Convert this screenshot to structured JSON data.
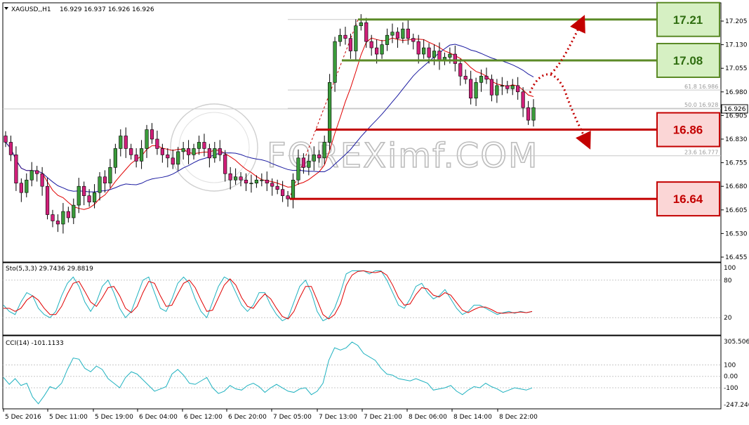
{
  "header": {
    "symbol_label": "XAGUSD,,H1",
    "ohlc": "16.929 16.937 16.926 16.926"
  },
  "watermark": "FOREXimf.COM",
  "chart_data": [
    {
      "type": "candlestick",
      "title": "XAGUSD,,H1",
      "ylim": [
        16.455,
        17.28
      ],
      "y_ticks": [
        "17.205",
        "17.130",
        "17.055",
        "16.980",
        "16.905",
        "16.830",
        "16.755",
        "16.680",
        "16.605",
        "16.530",
        "16.455"
      ],
      "y_tick_values": [
        17.205,
        17.13,
        17.055,
        16.98,
        16.905,
        16.83,
        16.755,
        16.68,
        16.605,
        16.53,
        16.455
      ],
      "current_price": "16.926",
      "x_ticks": [
        "5 Dec 2016",
        "5 Dec 11:00",
        "5 Dec 19:00",
        "6 Dec 04:00",
        "6 Dec 12:00",
        "6 Dec 20:00",
        "7 Dec 05:00",
        "7 Dec 13:00",
        "7 Dec 21:00",
        "8 Dec 06:00",
        "8 Dec 14:00",
        "8 Dec 22:00"
      ],
      "candles_close": [
        16.82,
        16.78,
        16.69,
        16.66,
        16.7,
        16.73,
        16.72,
        16.68,
        16.59,
        16.57,
        16.56,
        16.6,
        16.58,
        16.62,
        16.68,
        16.65,
        16.63,
        16.66,
        16.71,
        16.69,
        16.74,
        16.8,
        16.84,
        16.8,
        16.78,
        16.76,
        16.8,
        16.86,
        16.83,
        16.8,
        16.78,
        16.77,
        16.75,
        16.79,
        16.8,
        16.78,
        16.8,
        16.82,
        16.8,
        16.77,
        16.8,
        16.78,
        16.72,
        16.7,
        16.71,
        16.7,
        16.69,
        16.69,
        16.7,
        16.7,
        16.69,
        16.68,
        16.67,
        16.65,
        16.64,
        16.7,
        16.77,
        16.74,
        16.76,
        16.78,
        16.77,
        16.82,
        17.01,
        17.14,
        17.16,
        17.15,
        17.11,
        17.19,
        17.2,
        17.14,
        17.12,
        17.1,
        17.13,
        17.16,
        17.17,
        17.15,
        17.18,
        17.15,
        17.14,
        17.1,
        17.12,
        17.09,
        17.11,
        17.08,
        17.09,
        17.1,
        17.07,
        17.03,
        17.02,
        16.96,
        17.01,
        17.03,
        17.02,
        16.97,
        17.0,
        17.0,
        16.99,
        17.0,
        16.98,
        16.93,
        16.89,
        16.93
      ],
      "annotations": {
        "fib_levels": [
          "61.8 16.986",
          "50.0 16.928",
          "23.6 16.777"
        ]
      },
      "levels": [
        {
          "label": "17.21",
          "value": 17.21,
          "color": "#5b8a27"
        },
        {
          "label": "17.08",
          "value": 17.08,
          "color": "#5b8a27"
        },
        {
          "label": "16.86",
          "value": 16.86,
          "color": "#c30000"
        },
        {
          "label": "16.64",
          "value": 16.64,
          "color": "#c30000"
        }
      ]
    },
    {
      "type": "line",
      "title": "Sto(5,3,3) 29.7436 29.8819",
      "ylim": [
        0,
        100
      ],
      "y_ticks": [
        "100",
        "80",
        "20"
      ],
      "y_tick_values": [
        100,
        80,
        20
      ],
      "series": [
        {
          "values": [
            40,
            30,
            25,
            45,
            60,
            55,
            35,
            25,
            20,
            30,
            55,
            75,
            85,
            70,
            45,
            30,
            45,
            70,
            80,
            60,
            35,
            20,
            30,
            55,
            80,
            85,
            60,
            35,
            30,
            50,
            75,
            85,
            75,
            50,
            30,
            20,
            45,
            70,
            85,
            80,
            60,
            40,
            30,
            40,
            60,
            60,
            40,
            25,
            15,
            20,
            45,
            70,
            80,
            60,
            30,
            15,
            20,
            35,
            60,
            90,
            95,
            95,
            95,
            90,
            95,
            95,
            80,
            60,
            40,
            35,
            50,
            70,
            75,
            60,
            50,
            55,
            65,
            50,
            35,
            25,
            30,
            40,
            40,
            35,
            30,
            25,
            28,
            30,
            27,
            30,
            28,
            29.7
          ]
        },
        {
          "values": [
            35,
            35,
            30,
            35,
            48,
            55,
            48,
            35,
            25,
            25,
            38,
            58,
            75,
            78,
            62,
            45,
            38,
            52,
            68,
            70,
            55,
            35,
            28,
            38,
            60,
            78,
            75,
            55,
            38,
            40,
            58,
            75,
            80,
            68,
            48,
            30,
            32,
            52,
            72,
            82,
            72,
            52,
            38,
            35,
            48,
            58,
            50,
            35,
            22,
            18,
            30,
            52,
            70,
            70,
            48,
            25,
            18,
            25,
            42,
            72,
            88,
            94,
            95,
            93,
            92,
            94,
            88,
            72,
            52,
            40,
            42,
            57,
            68,
            66,
            56,
            53,
            60,
            56,
            44,
            32,
            28,
            33,
            37,
            37,
            33,
            28,
            27,
            28,
            28,
            29,
            28,
            29.9
          ]
        }
      ]
    },
    {
      "type": "line",
      "title": "CCI(14) -101.1133",
      "ylim": [
        -247.246,
        305.5063
      ],
      "y_ticks": [
        "305.5063",
        "100",
        "0.00",
        "-100",
        "-247.246"
      ],
      "y_tick_values": [
        305.5063,
        100,
        0,
        -100,
        -247.246
      ],
      "series": [
        {
          "values": [
            -10,
            -70,
            -20,
            -80,
            -60,
            -180,
            -240,
            -170,
            -90,
            -110,
            -60,
            60,
            160,
            150,
            70,
            40,
            90,
            60,
            -20,
            -60,
            -100,
            -10,
            40,
            20,
            -30,
            -80,
            -130,
            -110,
            -90,
            20,
            60,
            10,
            -60,
            -70,
            -40,
            -10,
            -100,
            -150,
            -130,
            -80,
            -110,
            -120,
            -80,
            -60,
            -90,
            -140,
            -100,
            -70,
            -100,
            -130,
            -140,
            -110,
            -100,
            -160,
            -130,
            -60,
            140,
            250,
            230,
            250,
            300,
            270,
            200,
            170,
            140,
            70,
            20,
            10,
            -20,
            -30,
            -40,
            -20,
            -40,
            -60,
            -120,
            -110,
            -100,
            -80,
            -130,
            -160,
            -120,
            -90,
            -100,
            -60,
            -90,
            -110,
            -140,
            -120,
            -100,
            -110,
            -120,
            -101
          ]
        }
      ]
    }
  ]
}
